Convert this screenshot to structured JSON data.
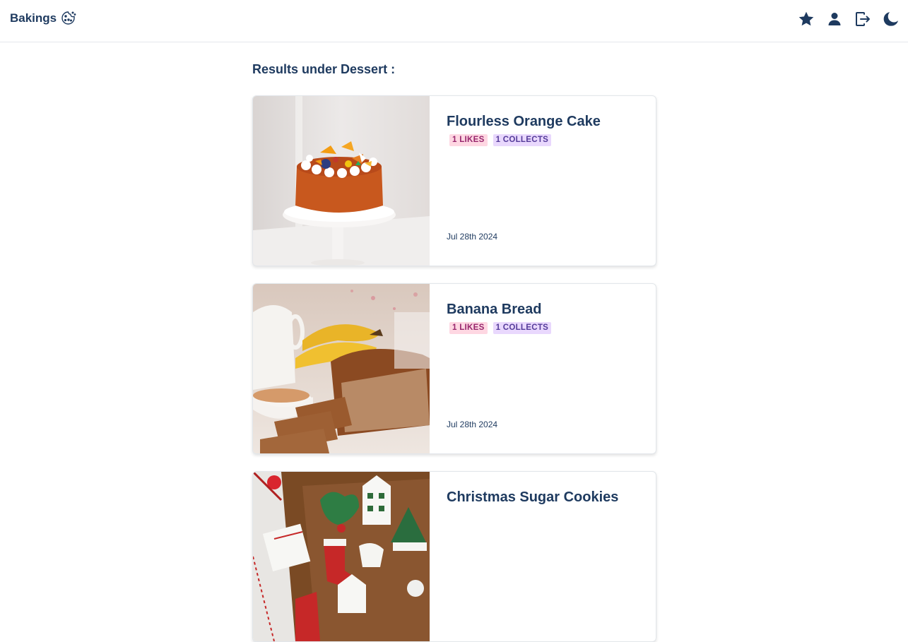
{
  "brand": {
    "name": "Bakings",
    "icon": "cookie-icon"
  },
  "nav": {
    "icons": [
      "star-icon",
      "user-icon",
      "logout-icon",
      "moon-icon"
    ]
  },
  "results": {
    "heading": "Results under Dessert :"
  },
  "recipes": [
    {
      "title": "Flourless Orange Cake",
      "likes": "1 LIKES",
      "collects": "1 COLLECTS",
      "date": "Jul 28th 2024",
      "image": "orange-cake-image"
    },
    {
      "title": "Banana Bread",
      "likes": "1 LIKES",
      "collects": "1 COLLECTS",
      "date": "Jul 28th 2024",
      "image": "banana-bread-image"
    },
    {
      "title": "Christmas Sugar Cookies",
      "image": "sugar-cookies-image"
    }
  ],
  "colors": {
    "primary": "#1e3a5f",
    "likes_badge_bg": "#fed7e2",
    "likes_badge_text": "#97266d",
    "collects_badge_bg": "#e9d8fd",
    "collects_badge_text": "#553c9a"
  }
}
